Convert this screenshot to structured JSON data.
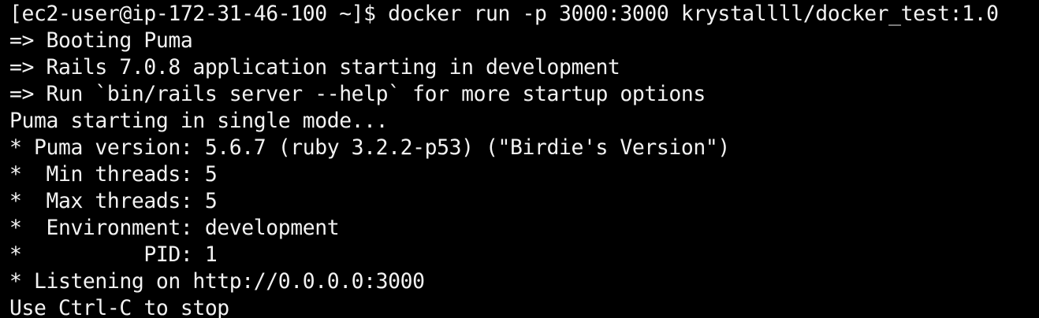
{
  "terminal": {
    "background": "#000000",
    "foreground": "#f2f2f2",
    "lines": [
      "[ec2-user@ip-172-31-46-100 ~]$ docker run -p 3000:3000 krystallll/docker_test:1.0",
      "=> Booting Puma",
      "=> Rails 7.0.8 application starting in development",
      "=> Run `bin/rails server --help` for more startup options",
      "Puma starting in single mode...",
      "* Puma version: 5.6.7 (ruby 3.2.2-p53) (\"Birdie's Version\")",
      "*  Min threads: 5",
      "*  Max threads: 5",
      "*  Environment: development",
      "*          PID: 1",
      "* Listening on http://0.0.0.0:3000",
      "Use Ctrl-C to stop"
    ]
  }
}
